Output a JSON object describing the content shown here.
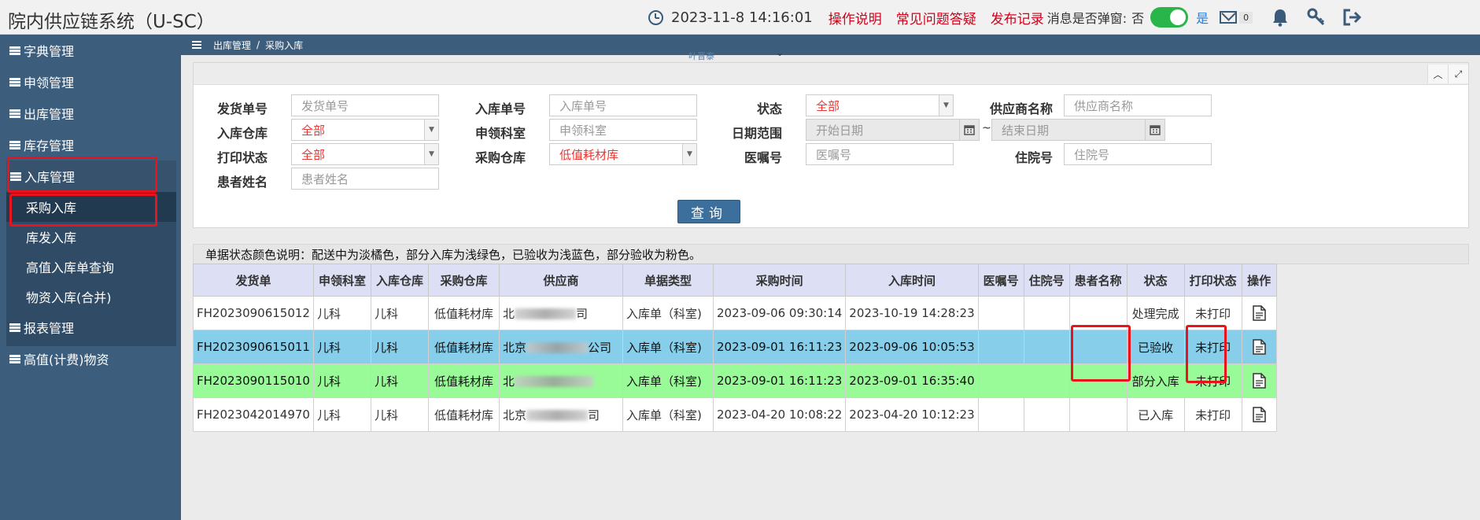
{
  "app": {
    "title": "院内供应链系统（U-SC）"
  },
  "topbar": {
    "datetime": "2023-11-8  14:16:01",
    "links": [
      "操作说明",
      "常见问题答疑",
      "发布记录"
    ],
    "popup_label": "消息是否弹窗:",
    "toggle_no": "否",
    "toggle_yes": "是",
    "mail_count": "0",
    "icons": [
      "clock-icon",
      "mail-icon",
      "bell-icon",
      "key-icon",
      "logout-icon"
    ]
  },
  "sidebar": {
    "items": [
      {
        "label": "字典管理"
      },
      {
        "label": "申领管理"
      },
      {
        "label": "出库管理"
      },
      {
        "label": "库存管理"
      },
      {
        "label": "入库管理"
      }
    ],
    "subitems": [
      {
        "label": "采购入库"
      },
      {
        "label": "库发入库"
      },
      {
        "label": "高值入库单查询"
      },
      {
        "label": "物资入库(合并)"
      }
    ],
    "items_after": [
      {
        "label": "报表管理"
      },
      {
        "label": "高值(计费)物资"
      }
    ]
  },
  "breadcrumb": {
    "parent": "出库管理",
    "sep": "/",
    "current": "采购入库",
    "ghost_text": "叶晋泰"
  },
  "search": {
    "labels": {
      "ship_no": "发货单号",
      "in_no": "入库单号",
      "status": "状态",
      "supplier": "供应商名称",
      "warehouse": "入库仓库",
      "dept": "申领科室",
      "date_range": "日期范围",
      "order_no": "医嘱号",
      "print_status": "打印状态",
      "purchase_wh": "采购仓库",
      "inpatient_no": "住院号",
      "patient_name": "患者姓名"
    },
    "placeholders": {
      "ship_no": "发货单号",
      "in_no": "入库单号",
      "supplier": "供应商名称",
      "dept": "申领科室",
      "start_date": "开始日期",
      "end_date": "结束日期",
      "order_no": "医嘱号",
      "inpatient_no": "住院号",
      "patient_name": "患者姓名"
    },
    "values": {
      "status": "全部",
      "warehouse": "全部",
      "print_status": "全部",
      "purchase_wh": "低值耗材库"
    },
    "tilde": "~",
    "query_button": "查询"
  },
  "legend": "单据状态颜色说明：配送中为淡橘色，部分入库为浅绿色，已验收为浅蓝色，部分验收为粉色。",
  "table": {
    "headers": [
      "发货单",
      "申领科室",
      "入库仓库",
      "采购仓库",
      "供应商",
      "单据类型",
      "采购时间",
      "入库时间",
      "医嘱号",
      "住院号",
      "患者名称",
      "状态",
      "打印状态",
      "操作"
    ],
    "rows": [
      {
        "ship": "FH2023090615012",
        "dept": "儿科",
        "wh": "儿科",
        "pwh": "低值耗材库",
        "sup_a": "北",
        "sup_b": "司",
        "type": "入库单（科室)",
        "ptime": "2023-09-06 09:30:14",
        "itime": "2023-10-19 14:28:23",
        "order": "",
        "inp": "",
        "patient": "",
        "status": "处理完成",
        "print": "未打印"
      },
      {
        "ship": "FH2023090615011",
        "dept": "儿科",
        "wh": "儿科",
        "pwh": "低值耗材库",
        "sup_a": "北京",
        "sup_b": "公司",
        "type": "入库单（科室)",
        "ptime": "2023-09-01 16:11:23",
        "itime": "2023-09-06 10:05:53",
        "order": "",
        "inp": "",
        "patient": "",
        "status": "已验收",
        "print": "未打印"
      },
      {
        "ship": "FH2023090115010",
        "dept": "儿科",
        "wh": "儿科",
        "pwh": "低值耗材库",
        "sup_a": "北",
        "sup_b": "",
        "type": "入库单（科室)",
        "ptime": "2023-09-01 16:11:23",
        "itime": "2023-09-01 16:35:40",
        "order": "",
        "inp": "",
        "patient": "",
        "status": "部分入库",
        "print": "未打印"
      },
      {
        "ship": "FH2023042014970",
        "dept": "儿科",
        "wh": "儿科",
        "pwh": "低值耗材库",
        "sup_a": "北京",
        "sup_b": "司",
        "type": "入库单（科室)",
        "ptime": "2023-04-20 10:08:22",
        "itime": "2023-04-20 10:12:23",
        "order": "",
        "inp": "",
        "patient": "",
        "status": "已入库",
        "print": "未打印"
      }
    ]
  },
  "colors": {
    "sidebar": "#3c5d7c",
    "row_accepted": "#87ceeb",
    "row_partial": "#98fb98",
    "link_red": "#d0021b",
    "highlight": "#e8131c"
  }
}
